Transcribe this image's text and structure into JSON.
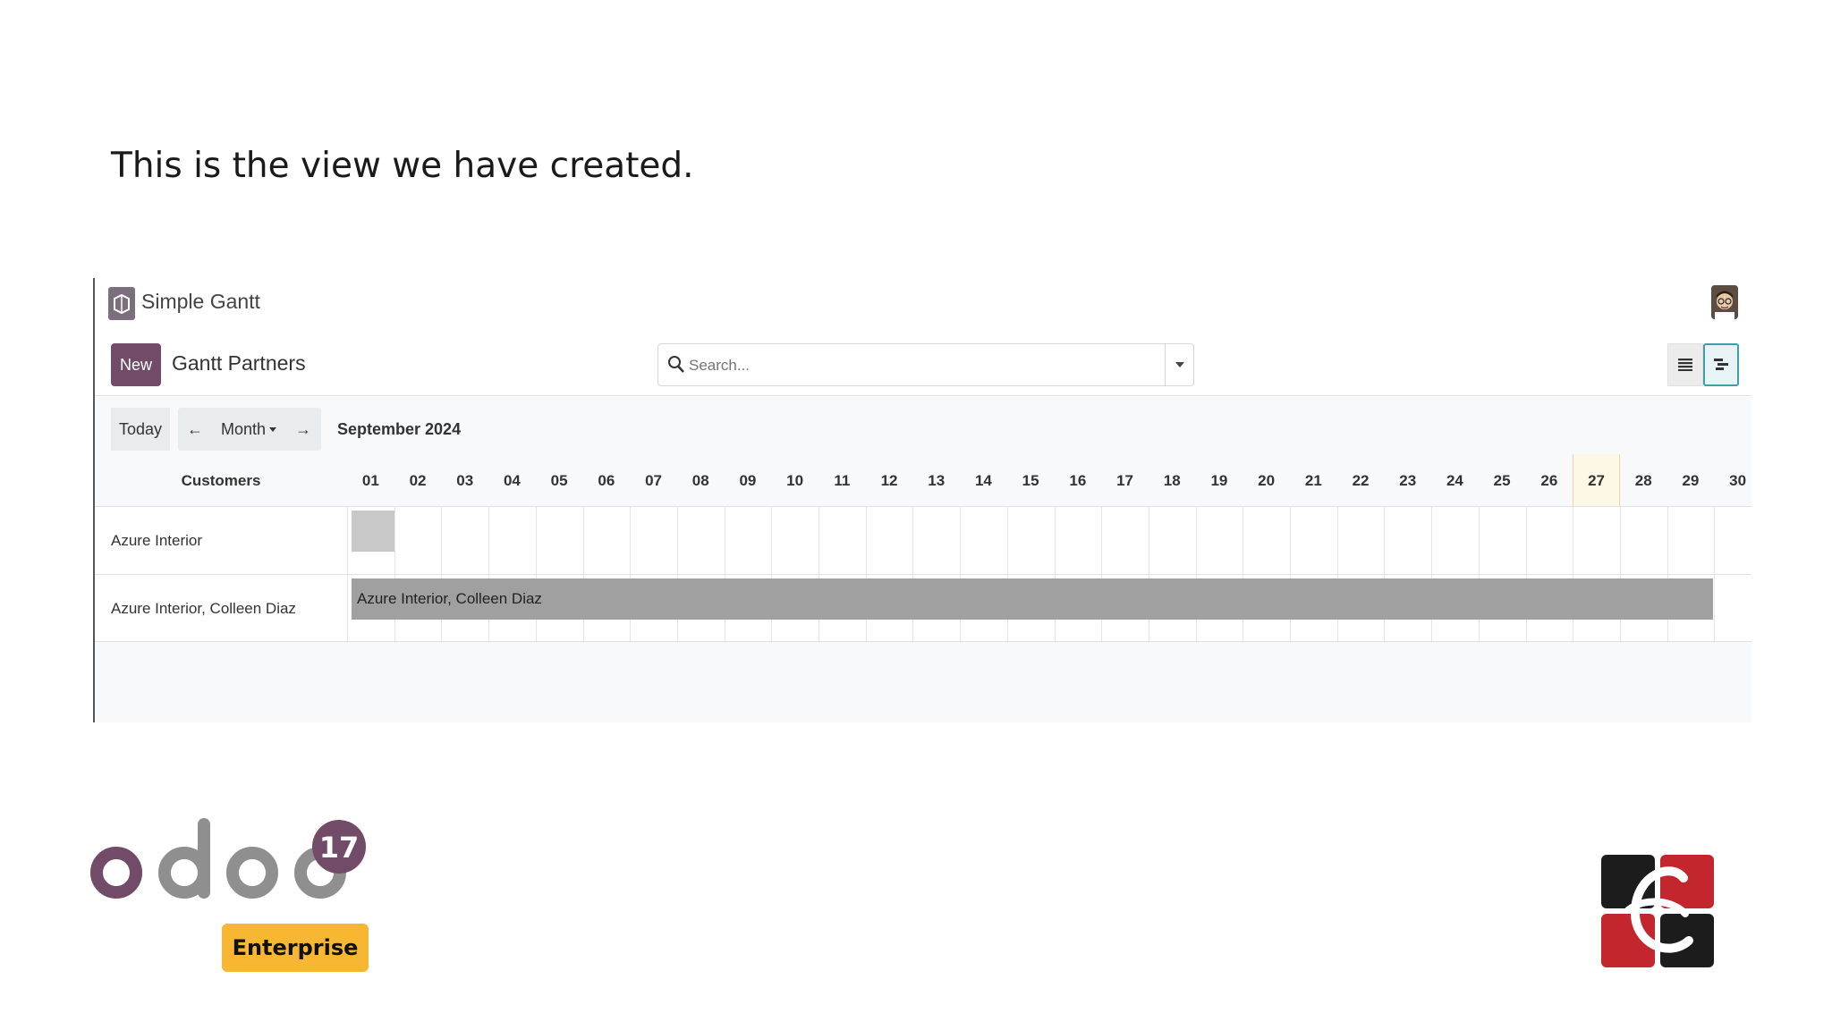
{
  "slide": {
    "caption": "This is the view we have created."
  },
  "app": {
    "name": "Simple Gantt",
    "new_label": "New",
    "view_title": "Gantt Partners",
    "search_placeholder": "Search...",
    "nav": {
      "today_label": "Today",
      "prev_symbol": "←",
      "scale_label": "Month",
      "next_symbol": "→",
      "period_label": "September 2024"
    },
    "gantt": {
      "row_header": "Customers",
      "days": [
        "01",
        "02",
        "03",
        "04",
        "05",
        "06",
        "07",
        "08",
        "09",
        "10",
        "11",
        "12",
        "13",
        "14",
        "15",
        "16",
        "17",
        "18",
        "19",
        "20",
        "21",
        "22",
        "23",
        "24",
        "25",
        "26",
        "27",
        "28",
        "29",
        "30"
      ],
      "today": "27",
      "rows": [
        {
          "label": "Azure Interior",
          "pill_text": ""
        },
        {
          "label": "Azure Interior, Colleen Diaz",
          "pill_text": "Azure Interior, Colleen Diaz"
        }
      ]
    }
  },
  "branding": {
    "odoo_wordmark": "odoo",
    "version_badge": "17",
    "edition_label": "Enterprise"
  },
  "colors": {
    "primary": "#714b67",
    "enterprise_badge": "#f7b733",
    "today_highlight": "#fdf8e6",
    "pill": "#a0a0a0"
  }
}
